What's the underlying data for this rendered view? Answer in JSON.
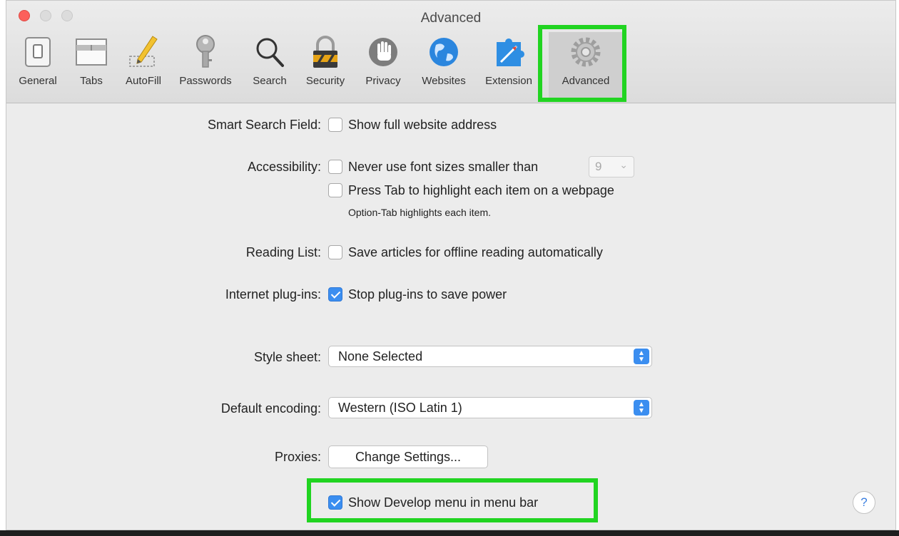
{
  "window": {
    "title": "Advanced"
  },
  "toolbar": {
    "items": [
      {
        "label": "General",
        "icon": "general-switch-icon"
      },
      {
        "label": "Tabs",
        "icon": "tabs-icon"
      },
      {
        "label": "AutoFill",
        "icon": "pencil-icon"
      },
      {
        "label": "Passwords",
        "icon": "key-icon"
      },
      {
        "label": "Search",
        "icon": "magnifier-icon"
      },
      {
        "label": "Security",
        "icon": "padlock-icon"
      },
      {
        "label": "Privacy",
        "icon": "hand-icon"
      },
      {
        "label": "Websites",
        "icon": "globe-icon"
      },
      {
        "label": "Extension",
        "icon": "puzzle-icon"
      },
      {
        "label": "Advanced",
        "icon": "gear-icon",
        "selected": true
      }
    ]
  },
  "settings": {
    "smart_search": {
      "label": "Smart Search Field:",
      "option": "Show full website address",
      "checked": false
    },
    "accessibility": {
      "label": "Accessibility:",
      "font_option": "Never use font sizes smaller than",
      "font_checked": false,
      "font_size": "9",
      "tab_option": "Press Tab to highlight each item on a webpage",
      "tab_checked": false,
      "tab_hint": "Option-Tab highlights each item."
    },
    "reading_list": {
      "label": "Reading List:",
      "option": "Save articles for offline reading automatically",
      "checked": false
    },
    "plugins": {
      "label": "Internet plug-ins:",
      "option": "Stop plug-ins to save power",
      "checked": true
    },
    "style_sheet": {
      "label": "Style sheet:",
      "value": "None Selected"
    },
    "encoding": {
      "label": "Default encoding:",
      "value": "Western (ISO Latin 1)"
    },
    "proxies": {
      "label": "Proxies:",
      "button": "Change Settings..."
    },
    "develop_menu": {
      "option": "Show Develop menu in menu bar",
      "checked": true
    }
  },
  "help": {
    "label": "?"
  },
  "colors": {
    "highlight": "#21d421",
    "accent": "#3b8ef0",
    "close": "#fc605b"
  }
}
